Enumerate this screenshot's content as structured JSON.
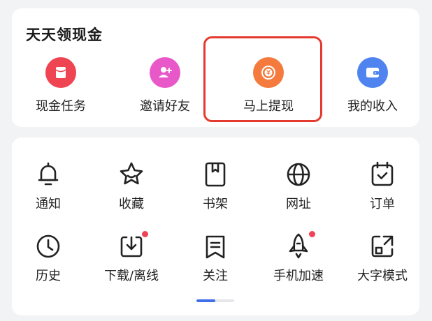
{
  "cash_section": {
    "title": "天天领现金",
    "items": [
      {
        "label": "现金任务",
        "icon": "red-envelope-icon",
        "color": "#ef4452"
      },
      {
        "label": "邀请好友",
        "icon": "add-user-icon",
        "color": "#e858c9"
      },
      {
        "label": "马上提现",
        "icon": "coin-withdraw-icon",
        "color": "#f47a3d"
      },
      {
        "label": "我的收入",
        "icon": "wallet-icon",
        "color": "#4f84f0"
      }
    ],
    "highlighted_item": "马上提现",
    "highlight_color": "#e53a2f"
  },
  "tools_section": {
    "items": [
      {
        "label": "通知",
        "icon": "bell-icon",
        "badge": false
      },
      {
        "label": "收藏",
        "icon": "star-icon",
        "badge": false
      },
      {
        "label": "书架",
        "icon": "bookshelf-icon",
        "badge": false
      },
      {
        "label": "网址",
        "icon": "globe-icon",
        "badge": false
      },
      {
        "label": "订单",
        "icon": "order-icon",
        "badge": false
      },
      {
        "label": "历史",
        "icon": "clock-icon",
        "badge": false
      },
      {
        "label": "下载/离线",
        "icon": "download-icon",
        "badge": true
      },
      {
        "label": "关注",
        "icon": "follow-icon",
        "badge": false
      },
      {
        "label": "手机加速",
        "icon": "rocket-icon",
        "badge": true
      },
      {
        "label": "大字模式",
        "icon": "large-font-icon",
        "badge": false
      }
    ],
    "badge_color": "#f04358",
    "pager": {
      "pages": 2,
      "current": 1,
      "active_color": "#3f6fe8"
    }
  }
}
